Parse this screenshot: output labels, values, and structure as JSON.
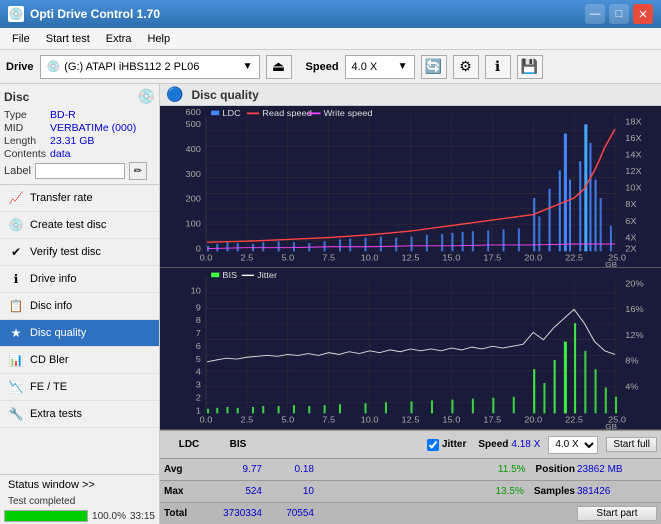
{
  "app": {
    "title": "Opti Drive Control 1.70",
    "icon": "💿"
  },
  "titlebar": {
    "minimize": "—",
    "maximize": "□",
    "close": "✕"
  },
  "menu": {
    "items": [
      "File",
      "Start test",
      "Extra",
      "Help"
    ]
  },
  "toolbar": {
    "drive_label": "Drive",
    "drive_value": "(G:) ATAPI iHBS112  2 PL06",
    "speed_label": "Speed",
    "speed_value": "4.0 X"
  },
  "disc": {
    "label": "Disc",
    "type_key": "Type",
    "type_val": "BD-R",
    "mid_key": "MID",
    "mid_val": "VERBATIMe (000)",
    "length_key": "Length",
    "length_val": "23.31 GB",
    "contents_key": "Contents",
    "contents_val": "data",
    "label_key": "Label",
    "label_val": ""
  },
  "nav": {
    "items": [
      {
        "id": "transfer-rate",
        "label": "Transfer rate",
        "icon": "📈",
        "active": false
      },
      {
        "id": "create-test-disc",
        "label": "Create test disc",
        "icon": "💿",
        "active": false
      },
      {
        "id": "verify-test-disc",
        "label": "Verify test disc",
        "icon": "✔",
        "active": false
      },
      {
        "id": "drive-info",
        "label": "Drive info",
        "icon": "ℹ",
        "active": false
      },
      {
        "id": "disc-info",
        "label": "Disc info",
        "icon": "📋",
        "active": false
      },
      {
        "id": "disc-quality",
        "label": "Disc quality",
        "icon": "★",
        "active": true
      },
      {
        "id": "cd-bler",
        "label": "CD Bler",
        "icon": "📊",
        "active": false
      },
      {
        "id": "fe-te",
        "label": "FE / TE",
        "icon": "📉",
        "active": false
      },
      {
        "id": "extra-tests",
        "label": "Extra tests",
        "icon": "🔧",
        "active": false
      }
    ]
  },
  "chart": {
    "title": "Disc quality",
    "icon": "🔵",
    "top": {
      "legend": [
        {
          "id": "ldc",
          "label": "LDC",
          "color": "#4488ff"
        },
        {
          "id": "read-speed",
          "label": "Read speed",
          "color": "#ff4444"
        },
        {
          "id": "write-speed",
          "label": "Write speed",
          "color": "#ff44ff"
        }
      ],
      "y_max": 600,
      "y_right_max": 18,
      "x_labels": [
        "0.0",
        "2.5",
        "5.0",
        "7.5",
        "10.0",
        "12.5",
        "15.0",
        "17.5",
        "20.0",
        "22.5",
        "25.0"
      ],
      "y_right_labels": [
        "18X",
        "16X",
        "14X",
        "12X",
        "10X",
        "8X",
        "6X",
        "4X",
        "2X"
      ]
    },
    "bottom": {
      "legend": [
        {
          "id": "bis",
          "label": "BIS",
          "color": "#44ff44"
        },
        {
          "id": "jitter",
          "label": "Jitter",
          "color": "#ffffff"
        }
      ],
      "y_max": 10,
      "y_right_max": 20,
      "x_labels": [
        "0.0",
        "2.5",
        "5.0",
        "7.5",
        "10.0",
        "12.5",
        "15.0",
        "17.5",
        "20.0",
        "22.5",
        "25.0"
      ],
      "y_right_labels": [
        "20%",
        "16%",
        "12%",
        "8%",
        "4%"
      ]
    }
  },
  "stats": {
    "columns": [
      "LDC",
      "BIS",
      "Jitter",
      "Speed",
      ""
    ],
    "avg_label": "Avg",
    "avg_ldc": "9.77",
    "avg_bis": "0.18",
    "avg_jitter": "11.5%",
    "avg_jitter_green": true,
    "max_label": "Max",
    "max_ldc": "524",
    "max_bis": "10",
    "max_jitter": "13.5%",
    "max_jitter_green": true,
    "total_label": "Total",
    "total_ldc": "3730334",
    "total_bis": "70554",
    "jitter_checked": true,
    "jitter_label": "Jitter",
    "speed_label": "Speed",
    "speed_val": "4.18 X",
    "speed_select": "4.0 X",
    "position_label": "Position",
    "position_val": "23862 MB",
    "samples_label": "Samples",
    "samples_val": "381426",
    "btn_start_full": "Start full",
    "btn_start_part": "Start part"
  },
  "bottom": {
    "status_window": "Status window >>",
    "status_text": "Test completed",
    "progress": 100,
    "progress_text": "100.0%",
    "time": "33:15"
  }
}
